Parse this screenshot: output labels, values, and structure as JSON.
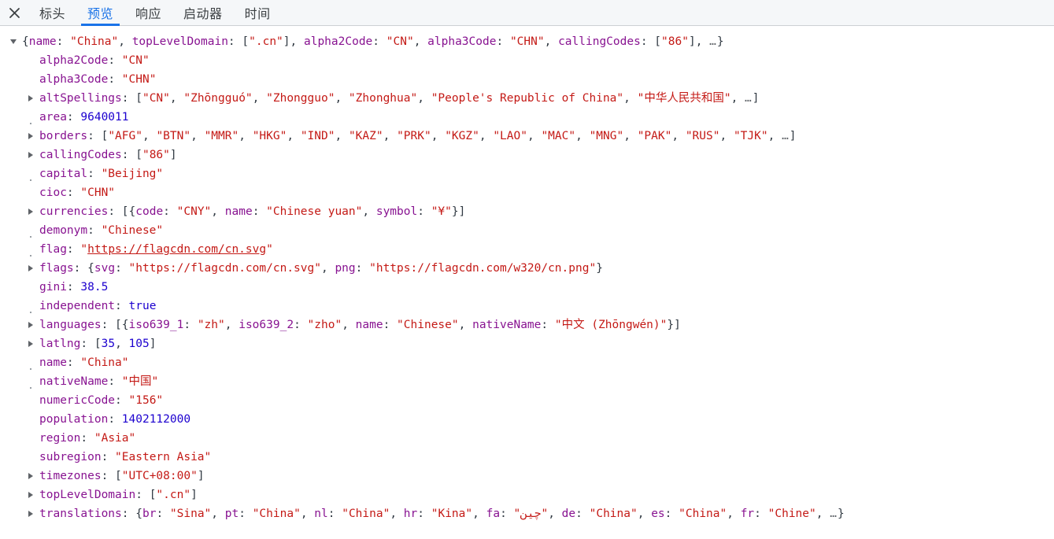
{
  "tabbar": {
    "close_label": "close-panel",
    "tabs": [
      {
        "label": "标头",
        "active": false
      },
      {
        "label": "预览",
        "active": true
      },
      {
        "label": "响应",
        "active": false
      },
      {
        "label": "启动器",
        "active": false
      },
      {
        "label": "时间",
        "active": false
      }
    ]
  },
  "colors": {
    "accent": "#1a73e8",
    "key": "#881391",
    "string": "#c41a16",
    "number": "#1c00cf",
    "tabbar_bg": "#f5f7f9",
    "text": "#303942"
  },
  "preview": {
    "root_summary": {
      "marker": "open-arrow",
      "text": "{name: \"China\", topLevelDomain: [\".cn\"], alpha2Code: \"CN\", alpha3Code: \"CHN\", callingCodes: [\"86\"], …}"
    },
    "rows": [
      {
        "marker": "none",
        "key": "alpha2Code",
        "value": "\"CN\"",
        "type": "string"
      },
      {
        "marker": "none",
        "key": "alpha3Code",
        "value": "\"CHN\"",
        "type": "string"
      },
      {
        "marker": "arrow",
        "key": "altSpellings",
        "value": "[\"CN\", \"Zhōngguó\", \"Zhongguo\", \"Zhonghua\", \"People's Republic of China\", \"中华人民共和国\", …]",
        "type": "mixed"
      },
      {
        "marker": "dot",
        "key": "area",
        "value": "9640011",
        "type": "number"
      },
      {
        "marker": "arrow",
        "key": "borders",
        "value": "[\"AFG\", \"BTN\", \"MMR\", \"HKG\", \"IND\", \"KAZ\", \"PRK\", \"KGZ\", \"LAO\", \"MAC\", \"MNG\", \"PAK\", \"RUS\", \"TJK\", …]",
        "type": "mixed"
      },
      {
        "marker": "arrow",
        "key": "callingCodes",
        "value": "[\"86\"]",
        "type": "mixed"
      },
      {
        "marker": "dot",
        "key": "capital",
        "value": "\"Beijing\"",
        "type": "string"
      },
      {
        "marker": "none",
        "key": "cioc",
        "value": "\"CHN\"",
        "type": "string"
      },
      {
        "marker": "arrow",
        "key": "currencies",
        "value": "[{code: \"CNY\", name: \"Chinese yuan\", symbol: \"¥\"}]",
        "type": "mixed"
      },
      {
        "marker": "dot",
        "key": "demonym",
        "value": "\"Chinese\"",
        "type": "string"
      },
      {
        "marker": "dot",
        "key": "flag",
        "value": "\"https://flagcdn.com/cn.svg\"",
        "type": "link"
      },
      {
        "marker": "arrow",
        "key": "flags",
        "value": "{svg: \"https://flagcdn.com/cn.svg\", png: \"https://flagcdn.com/w320/cn.png\"}",
        "type": "mixed"
      },
      {
        "marker": "none",
        "key": "gini",
        "value": "38.5",
        "type": "number"
      },
      {
        "marker": "dot",
        "key": "independent",
        "value": "true",
        "type": "boolean"
      },
      {
        "marker": "arrow",
        "key": "languages",
        "value": "[{iso639_1: \"zh\", iso639_2: \"zho\", name: \"Chinese\", nativeName: \"中文 (Zhōngwén)\"}]",
        "type": "mixed"
      },
      {
        "marker": "arrow",
        "key": "latlng",
        "value": "[35, 105]",
        "type": "mixed"
      },
      {
        "marker": "dot",
        "key": "name",
        "value": "\"China\"",
        "type": "string"
      },
      {
        "marker": "dot",
        "key": "nativeName",
        "value": "\"中国\"",
        "type": "string"
      },
      {
        "marker": "none",
        "key": "numericCode",
        "value": "\"156\"",
        "type": "string"
      },
      {
        "marker": "none",
        "key": "population",
        "value": "1402112000",
        "type": "number"
      },
      {
        "marker": "none",
        "key": "region",
        "value": "\"Asia\"",
        "type": "string"
      },
      {
        "marker": "none",
        "key": "subregion",
        "value": "\"Eastern Asia\"",
        "type": "string"
      },
      {
        "marker": "arrow",
        "key": "timezones",
        "value": "[\"UTC+08:00\"]",
        "type": "mixed"
      },
      {
        "marker": "arrow",
        "key": "topLevelDomain",
        "value": "[\".cn\"]",
        "type": "mixed"
      },
      {
        "marker": "arrow",
        "key": "translations",
        "value": "{br: \"Sina\", pt: \"China\", nl: \"China\", hr: \"Kina\", fa: \"چین\", de: \"China\", es: \"China\", fr: \"Chine\", …}",
        "type": "mixed"
      }
    ]
  }
}
